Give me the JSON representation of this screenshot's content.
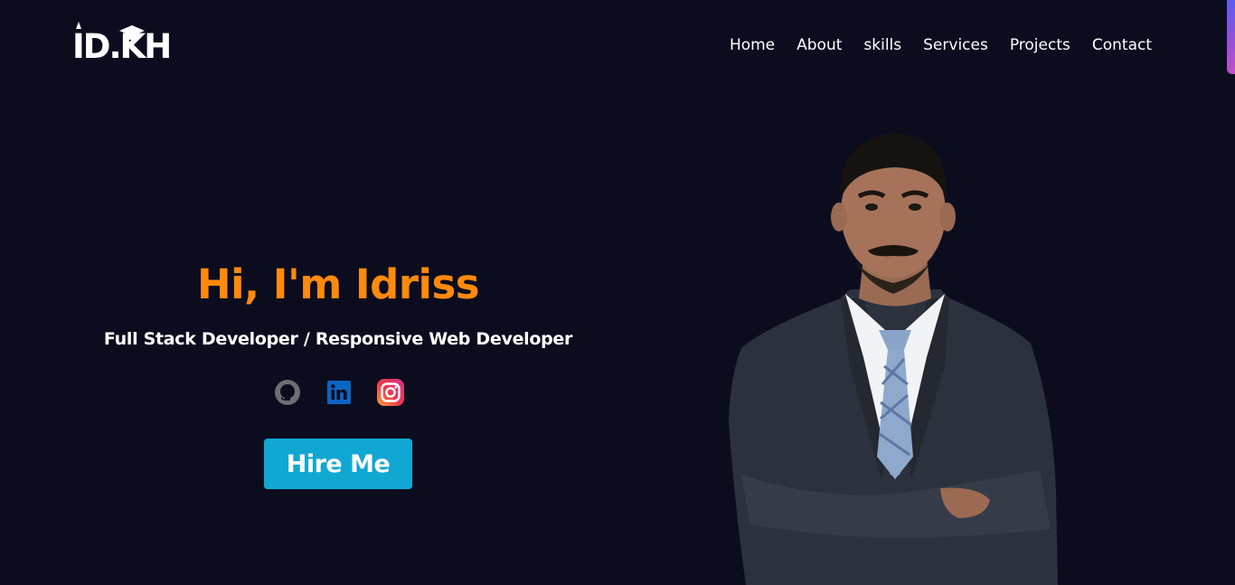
{
  "header": {
    "logo_text": "ID.KH",
    "nav": [
      {
        "label": "Home"
      },
      {
        "label": "About"
      },
      {
        "label": "skills"
      },
      {
        "label": "Services"
      },
      {
        "label": "Projects"
      },
      {
        "label": "Contact"
      }
    ]
  },
  "hero": {
    "title": "Hi, I'm Idriss",
    "subtitle": "Full Stack Developer / Responsive Web Developer",
    "cta_label": "Hire Me",
    "socials": [
      {
        "icon": "github-icon"
      },
      {
        "icon": "linkedin-icon"
      },
      {
        "icon": "instagram-icon"
      }
    ]
  },
  "colors": {
    "background": "#0b0d1f",
    "accent_orange": "#ff8a0c",
    "button": "#10a7d2",
    "text": "#ffffff"
  }
}
